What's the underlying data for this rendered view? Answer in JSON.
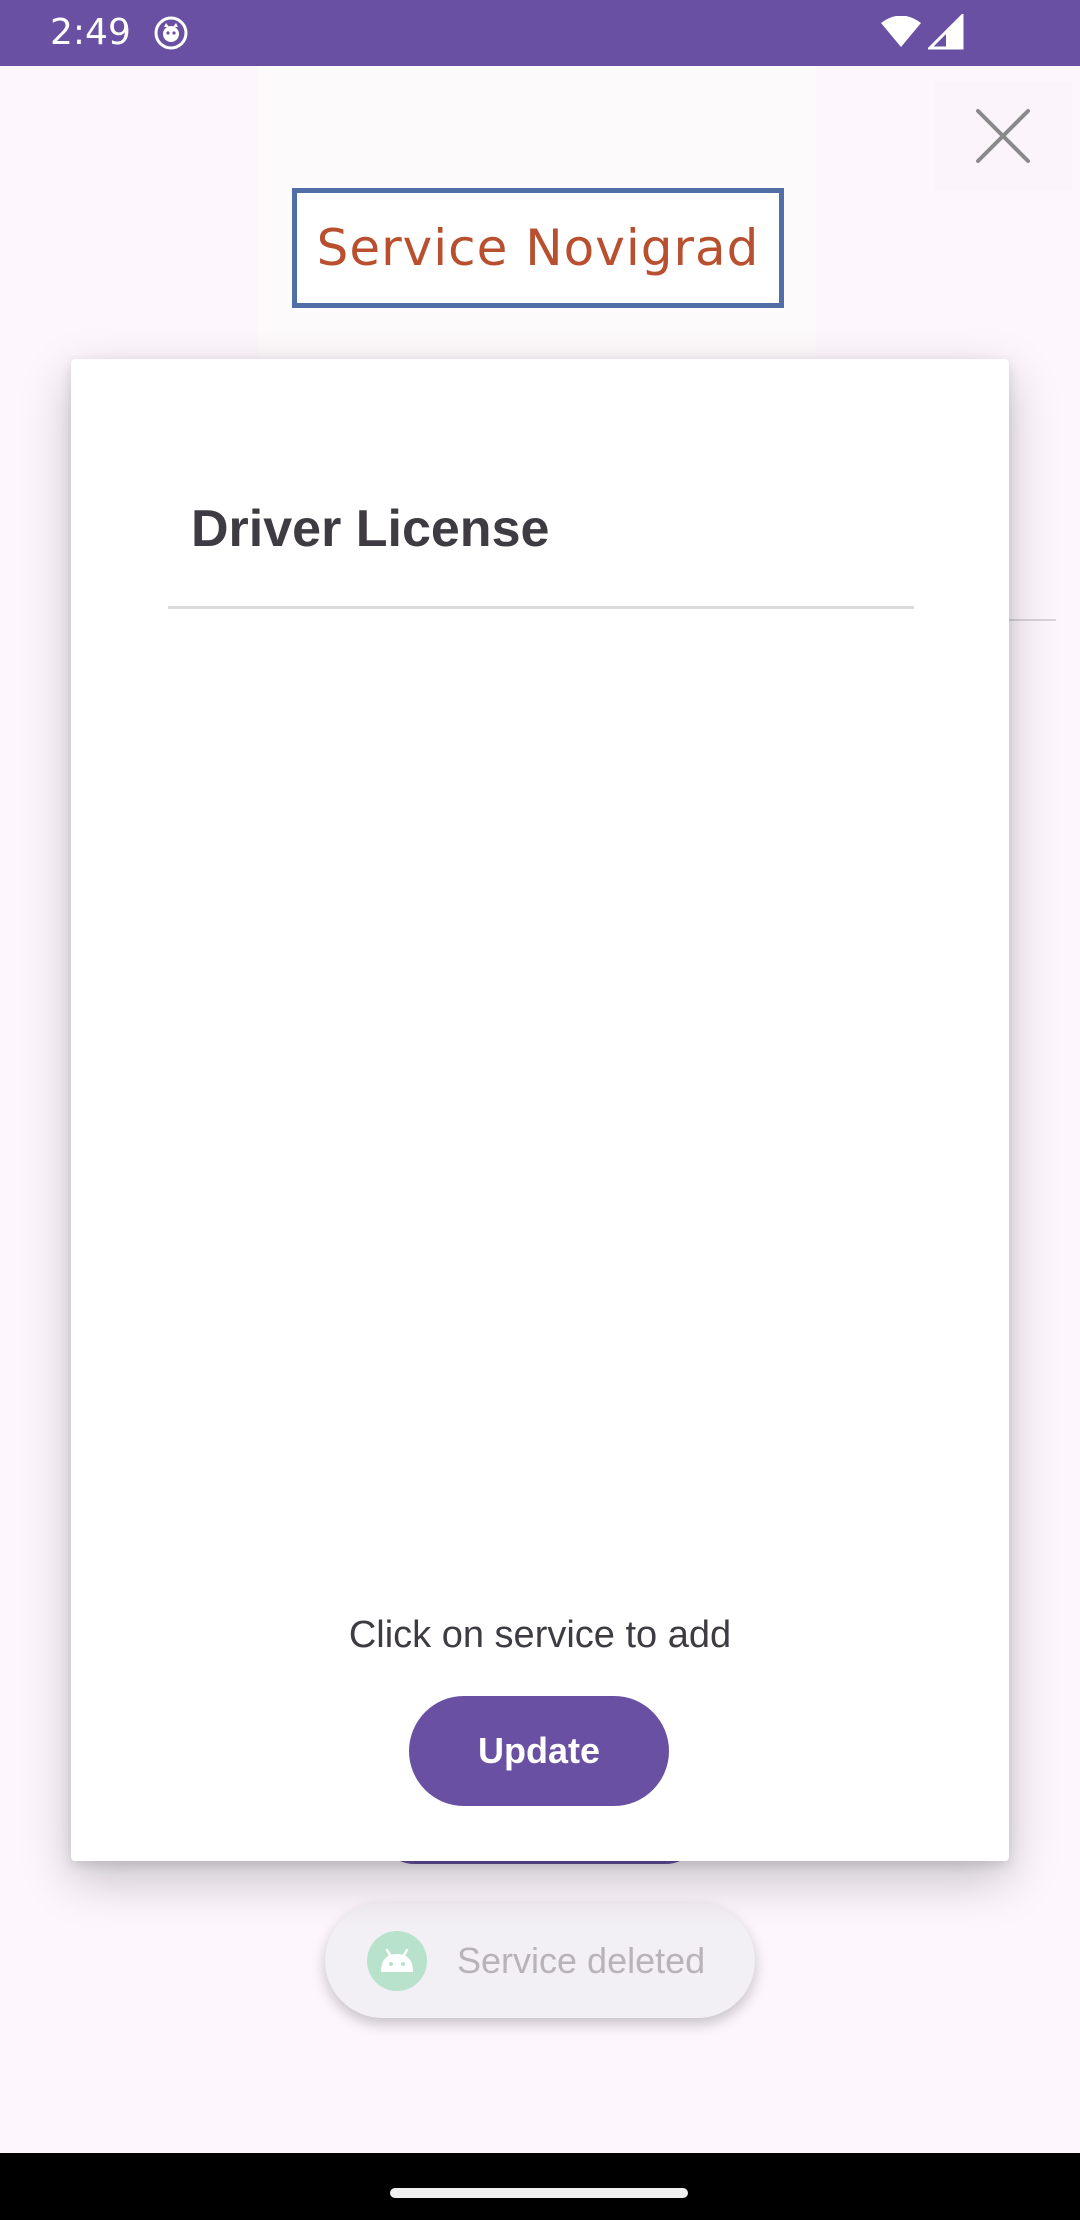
{
  "status_bar": {
    "time": "2:49",
    "icons": [
      "app-notification-icon",
      "wifi-icon",
      "signal-icon"
    ],
    "color": "#6950a3"
  },
  "header": {
    "logo_text": "Service Novigrad",
    "logo_text_color": "#b8502f",
    "logo_border_color": "#4f6fa6",
    "close_icon": "close-icon"
  },
  "dialog": {
    "title": "Driver License",
    "list_items": [],
    "hint": "Click on service to add",
    "update_label": "Update",
    "accent_color": "#6950a3"
  },
  "toast": {
    "message": "Service deleted",
    "icon": "android-icon"
  },
  "nav_bar": {
    "handle": "home-handle"
  }
}
